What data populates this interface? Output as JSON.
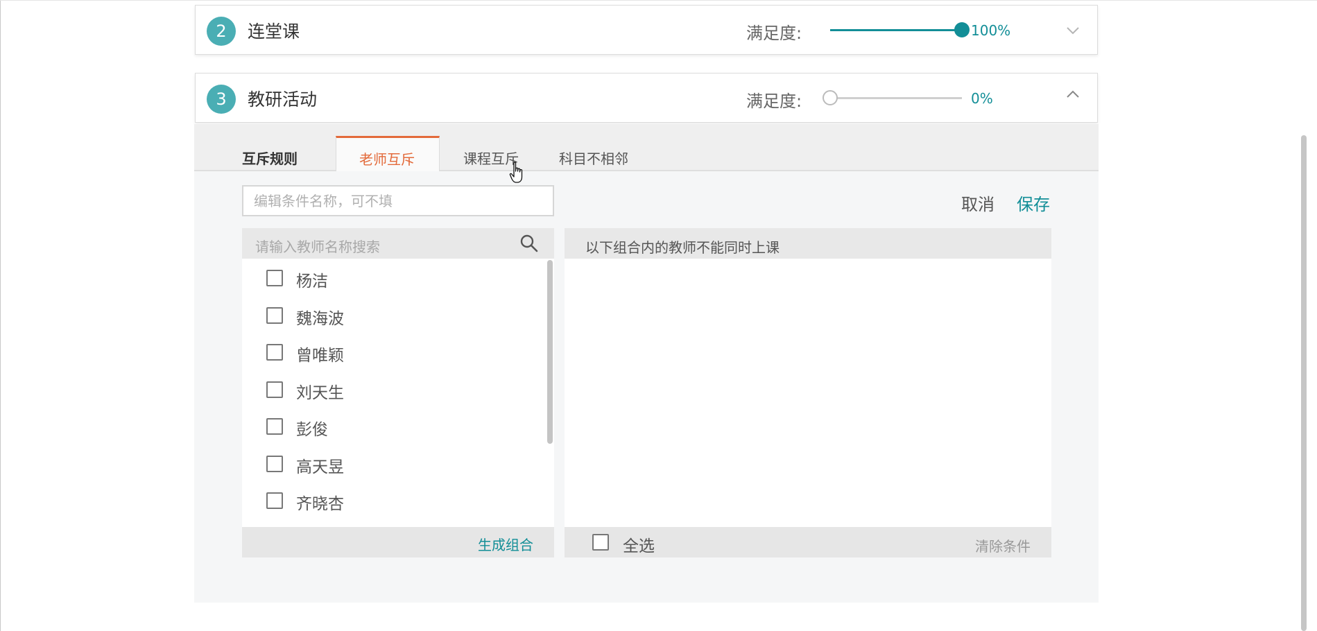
{
  "panels": [
    {
      "number": "2",
      "title": "连堂课",
      "satisfaction_label": "满足度:",
      "satisfaction_value": 1.0,
      "satisfaction_text": "100%",
      "expanded": false
    },
    {
      "number": "3",
      "title": "教研活动",
      "satisfaction_label": "满足度:",
      "satisfaction_value": 0.0,
      "satisfaction_text": "0%",
      "expanded": true
    }
  ],
  "rules": {
    "label": "互斥规则",
    "tabs": [
      {
        "label": "老师互斥",
        "active": true
      },
      {
        "label": "课程互斥",
        "active": false
      },
      {
        "label": "科目不相邻",
        "active": false
      }
    ]
  },
  "condition": {
    "placeholder": "编辑条件名称，可不填",
    "value": ""
  },
  "actions": {
    "cancel": "取消",
    "save": "保存"
  },
  "teacher_list": {
    "search_placeholder": "请输入教师名称搜索",
    "teachers": [
      "杨洁",
      "魏海波",
      "曾唯颖",
      "刘天生",
      "彭俊",
      "高天昱",
      "齐晓杏"
    ],
    "generate_label": "生成组合"
  },
  "groups": {
    "header": "以下组合内的教师不能同时上课",
    "select_all": "全选",
    "clear": "清除条件"
  },
  "colors": {
    "accent": "#128e97",
    "active_tab": "#e36a3a",
    "badge": "#4aaeb4"
  }
}
